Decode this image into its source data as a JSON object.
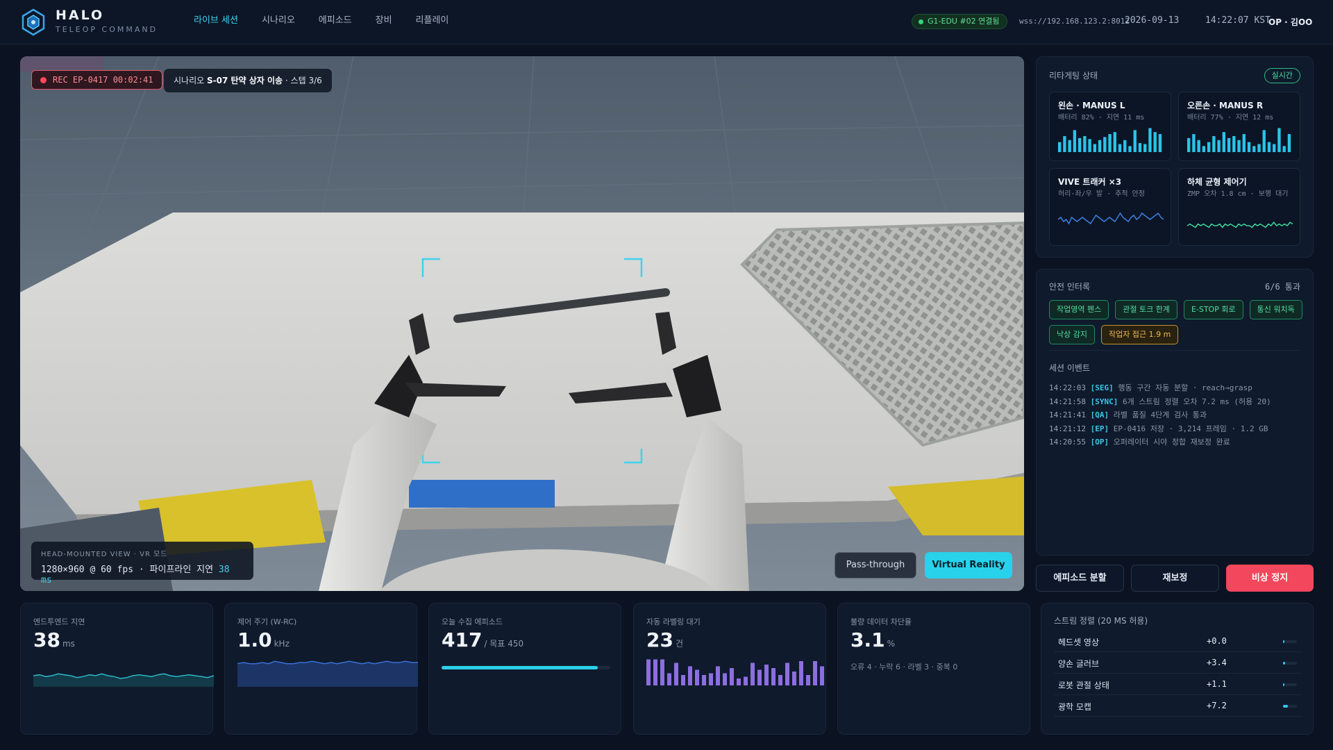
{
  "app": {
    "title": "HALO",
    "subtitle": "TELEOP COMMAND"
  },
  "nav": [
    {
      "label": "라이브 세션",
      "active": true
    },
    {
      "label": "시나리오",
      "active": false
    },
    {
      "label": "에피소드",
      "active": false
    },
    {
      "label": "장비",
      "active": false
    },
    {
      "label": "리플레이",
      "active": false
    }
  ],
  "status": {
    "connection": "G1-EDU #02 연결됨",
    "ws_url": "wss://192.168.123.2:8012",
    "date": "2026-09-13",
    "time": "14:22:07 KST",
    "operator": "OP · 김OO"
  },
  "view": {
    "rec_text": "REC  EP-0417  00:02:41",
    "scenario_prefix": "시나리오",
    "scenario_name": "S-07 탄약 상자 이송",
    "scenario_step": "· 스텝 3/6",
    "hmv_label": "HEAD-MOUNTED VIEW · VR 모드",
    "hmv_info": "1280×960 @ 60 fps · 파이프라인 지연",
    "hmv_latency": "38 ms",
    "btn_passthrough": "Pass-through",
    "btn_vr": "Virtual Reality"
  },
  "retarget": {
    "title": "리타게팅 상태",
    "badge": "실시간",
    "cards": [
      {
        "title": "왼손 · MANUS L",
        "sub": "배터리 82% · 지연 11 ms",
        "chart": "bars",
        "color": "#2bc4e8",
        "values": [
          10,
          16,
          12,
          22,
          14,
          16,
          13,
          8,
          12,
          15,
          18,
          20,
          8,
          12,
          6,
          22,
          9,
          8,
          24,
          20,
          18
        ]
      },
      {
        "title": "오른손 · MANUS R",
        "sub": "배터리 77% · 지연 12 ms",
        "chart": "bars",
        "color": "#2bc4e8",
        "values": [
          14,
          18,
          12,
          6,
          10,
          16,
          12,
          20,
          14,
          16,
          12,
          18,
          10,
          6,
          8,
          22,
          10,
          8,
          24,
          6,
          18
        ]
      },
      {
        "title": "VIVE 트래커 ×3",
        "sub": "허리·좌/우 발 · 추적 안정",
        "chart": "line",
        "color": "#3f7fe0",
        "values": [
          5,
          6,
          4,
          5,
          3,
          6,
          5,
          4,
          5,
          6,
          5,
          4,
          3,
          5,
          7,
          6,
          5,
          4,
          5,
          6,
          5,
          4,
          6,
          8,
          6,
          5,
          4,
          6,
          7,
          5,
          6,
          8,
          7,
          6,
          5,
          6,
          7,
          8,
          6,
          5
        ]
      },
      {
        "title": "하체 균형 제어기",
        "sub": "ZMP 오차 1.8 cm · 보행 대기",
        "chart": "line",
        "color": "#3fd79a",
        "values": [
          5,
          6,
          5,
          4,
          6,
          5,
          6,
          5,
          4,
          6,
          5,
          5,
          6,
          4,
          6,
          5,
          6,
          5,
          4,
          6,
          5,
          6,
          5,
          5,
          4,
          6,
          5,
          6,
          5,
          4,
          6,
          5,
          7,
          5,
          6,
          5,
          6,
          5,
          7,
          6
        ]
      }
    ]
  },
  "safety": {
    "title": "안전 인터록",
    "pass_count": "6/6 통과",
    "tags": [
      {
        "label": "작업영역 펜스",
        "warn": false
      },
      {
        "label": "관절 토크 한계",
        "warn": false
      },
      {
        "label": "E-STOP 회로",
        "warn": false
      },
      {
        "label": "통신 워치독",
        "warn": false
      },
      {
        "label": "낙상 감지",
        "warn": false
      },
      {
        "label": "작업자 접근 1.9 m",
        "warn": true
      }
    ],
    "events_title": "세션 이벤트",
    "events": [
      {
        "time": "14:22:03",
        "tag": "[SEG]",
        "text": "행동 구간 자동 분할 · reach→grasp"
      },
      {
        "time": "14:21:58",
        "tag": "[SYNC]",
        "text": "6개 스트림 정렬 오차 7.2 ms (허용 20)"
      },
      {
        "time": "14:21:41",
        "tag": "[QA]",
        "text": "라벨 품질 4단계 검사 통과"
      },
      {
        "time": "14:21:12",
        "tag": "[EP]",
        "text": "EP-0416 저장 · 3,214 프레임 · 1.2 GB"
      },
      {
        "time": "14:20:55",
        "tag": "[OP]",
        "text": "오퍼레이터 시야 정합 재보정 완료"
      }
    ]
  },
  "actions": {
    "split": "에피소드 분할",
    "recal": "재보정",
    "estop": "비상 정지"
  },
  "stats": {
    "latency": {
      "label": "엔드투엔드 지연",
      "value": "38",
      "unit": "ms",
      "values": [
        12,
        13,
        11,
        12,
        14,
        13,
        12,
        10,
        11,
        13,
        12,
        14,
        12,
        11,
        9,
        10,
        12,
        13,
        12,
        11,
        13,
        14,
        12,
        11,
        12,
        13,
        12,
        11,
        10,
        12
      ]
    },
    "control": {
      "label": "제어 주기 (W-RC)",
      "value": "1.0",
      "unit": "kHz",
      "values": [
        20,
        21,
        20,
        20,
        21,
        20,
        22,
        21,
        20,
        20,
        21,
        21,
        22,
        21,
        20,
        21,
        20,
        21,
        22,
        21,
        20,
        21,
        20,
        21,
        22,
        21,
        21,
        22,
        21,
        21
      ]
    },
    "episodes": {
      "label": "오늘 수집 에피소드",
      "value": "417",
      "unit": "/ 목표 450",
      "progress": 0.927
    },
    "labeling": {
      "label": "자동 라벨링 대기",
      "value": "23",
      "unit": "건",
      "values": [
        30,
        30,
        30,
        14,
        26,
        12,
        22,
        18,
        12,
        14,
        22,
        14,
        20,
        8,
        10,
        26,
        18,
        24,
        20,
        12,
        26,
        16,
        28,
        12,
        28,
        22
      ]
    },
    "blocked": {
      "label": "불량 데이터 차단율",
      "value": "3.1",
      "unit": "%",
      "sub": "오류 4 · 누락 6 · 라벨 3 · 중복 0"
    }
  },
  "streams": {
    "title": "스트림 정렬 (20 MS 허용)",
    "rows": [
      {
        "name": "헤드셋 영상",
        "value": "+0.0",
        "level": 0.0
      },
      {
        "name": "양손 글러브",
        "value": "+3.4",
        "level": 0.17
      },
      {
        "name": "로봇 관절 상태",
        "value": "+1.1",
        "level": 0.06
      },
      {
        "name": "광학 모캡",
        "value": "+7.2",
        "level": 0.36
      }
    ]
  }
}
